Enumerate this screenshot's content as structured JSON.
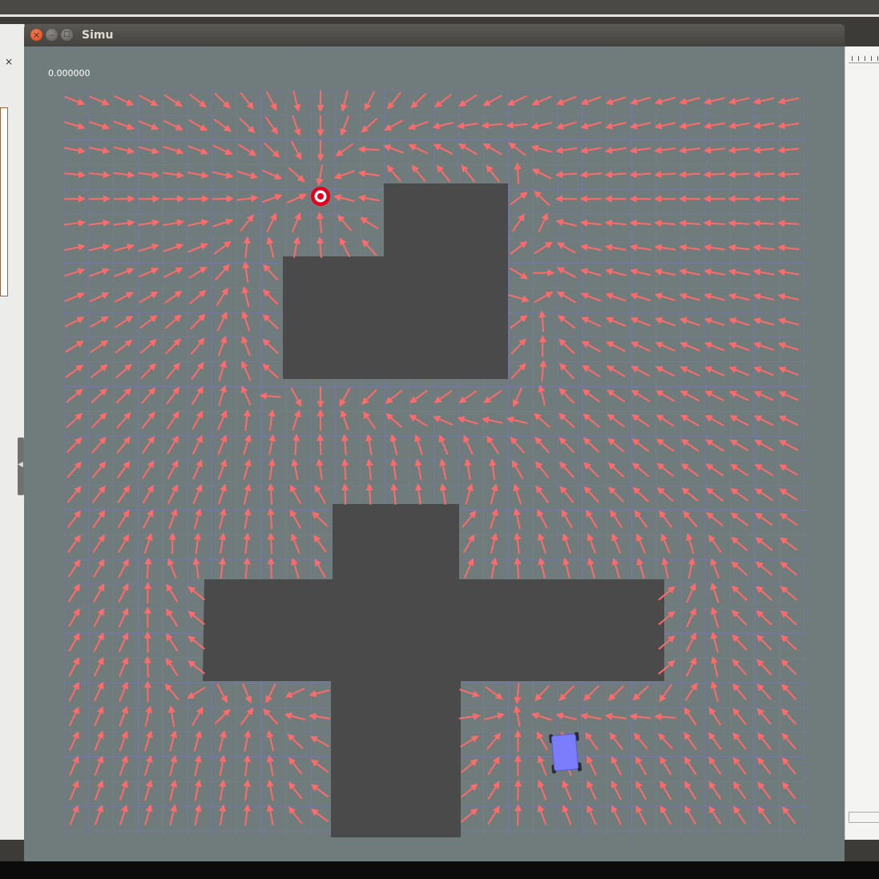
{
  "window": {
    "title": "Simu"
  },
  "simulation": {
    "time": "0.000000",
    "colors": {
      "background": "#707b7b",
      "obstacle": "#4a4a4a",
      "arrow": "#ff6b6b",
      "grid": "#7f7ae0",
      "robot": "#7c7cff",
      "goal_ring": "#e4001a"
    }
  },
  "icons": {
    "close": "close-icon",
    "minimize": "minimize-icon",
    "maximize": "maximize-icon",
    "goal": "target-icon",
    "robot": "robot-icon"
  },
  "background_windows": {
    "left_close_glyph": "×"
  }
}
